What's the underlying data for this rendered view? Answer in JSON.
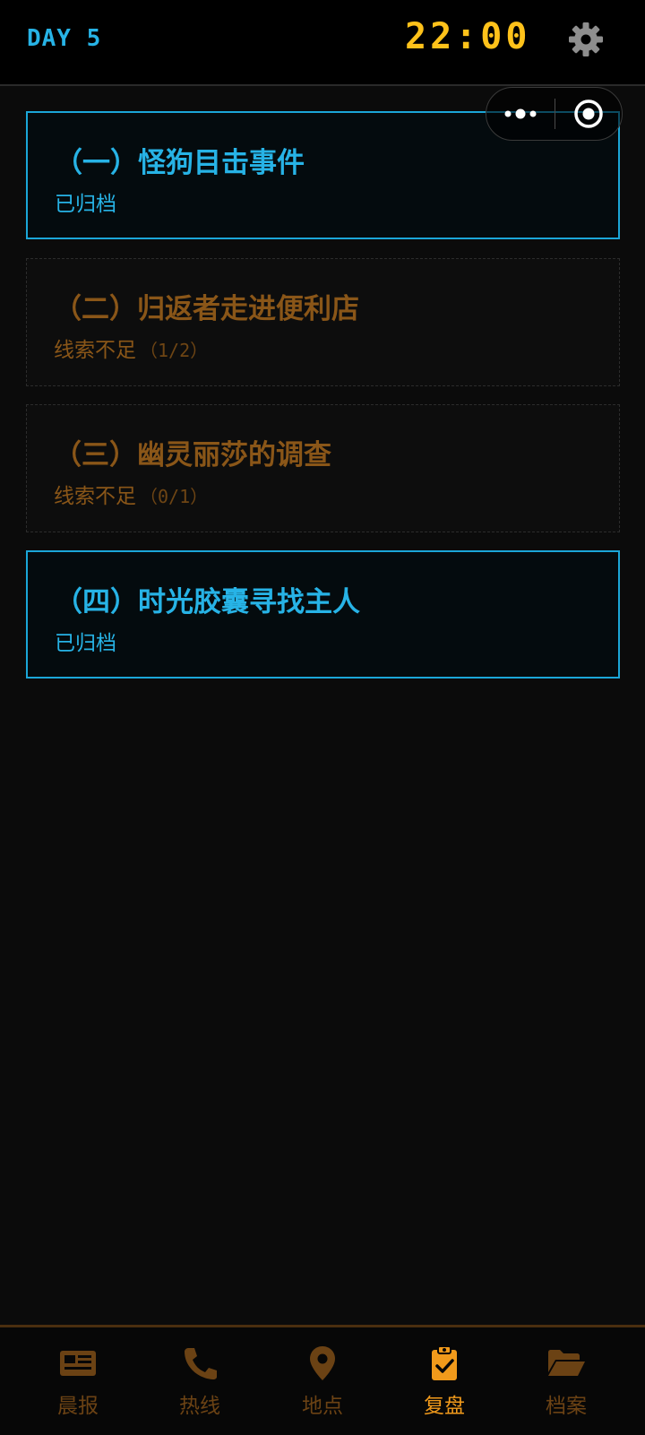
{
  "header": {
    "day": "DAY 5",
    "time": "22:00"
  },
  "cases": [
    {
      "title": "（一）怪狗目击事件",
      "status": "已归档",
      "progress": ""
    },
    {
      "title": "（二）归返者走进便利店",
      "status": "线索不足",
      "progress": "（1/2）"
    },
    {
      "title": "（三）幽灵丽莎的调查",
      "status": "线索不足",
      "progress": "（0/1）"
    },
    {
      "title": "（四）时光胶囊寻找主人",
      "status": "已归档",
      "progress": ""
    }
  ],
  "tabs": [
    {
      "label": "晨报",
      "icon": "newspaper-icon"
    },
    {
      "label": "热线",
      "icon": "phone-icon"
    },
    {
      "label": "地点",
      "icon": "map-pin-icon"
    },
    {
      "label": "复盘",
      "icon": "clipboard-check-icon",
      "active": true
    },
    {
      "label": "档案",
      "icon": "folder-open-icon"
    }
  ],
  "colors": {
    "accent_blue": "#27b3e6",
    "clock_yellow": "#ffc21a",
    "pending_brown": "#8a5618",
    "active_orange": "#f19a1b",
    "inactive_tab": "#6b4214"
  }
}
